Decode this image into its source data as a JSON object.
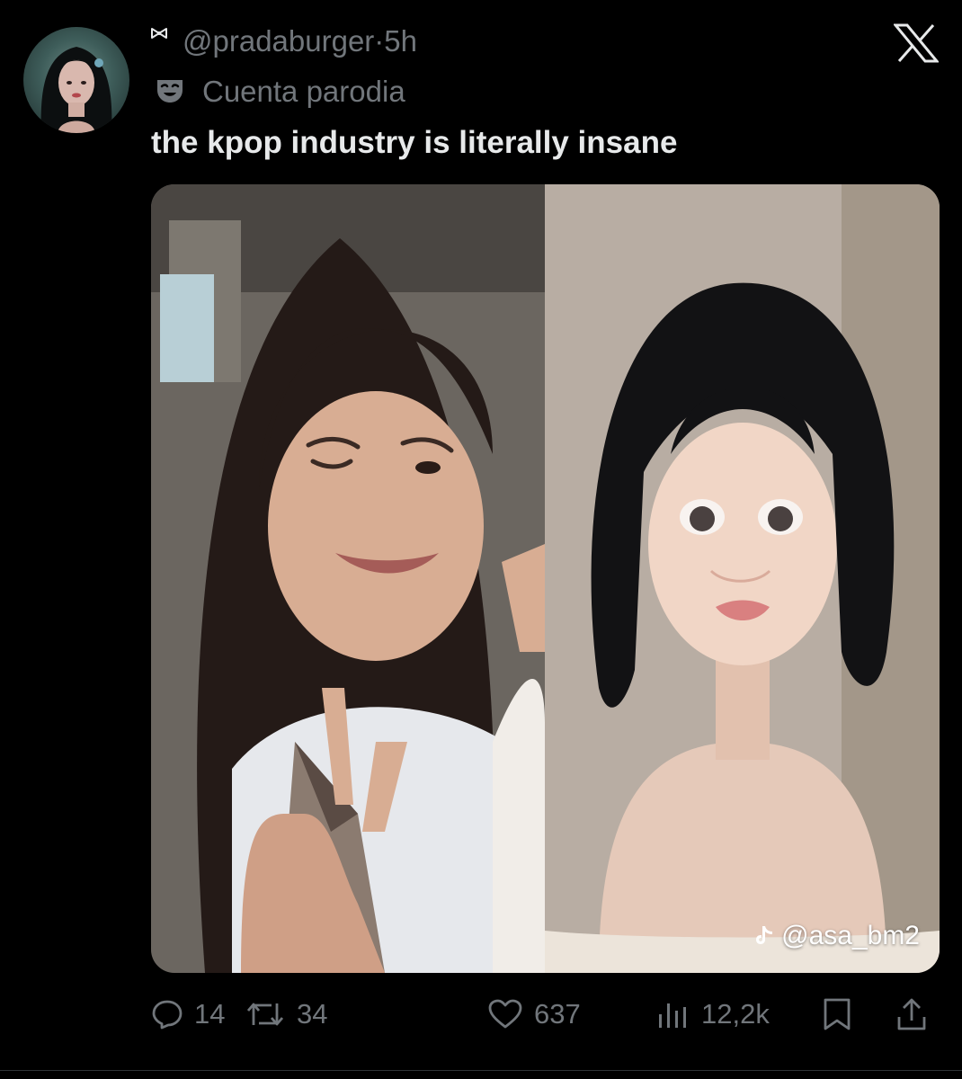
{
  "tweet": {
    "handle": "@pradaburger",
    "separator": "·",
    "time": "5h",
    "account_label": "Cuenta parodia",
    "text": "the kpop industry is literally insane",
    "avatar_icon": "user-avatar",
    "label_icon": "theater-mask-icon",
    "media": {
      "left_photo": "selfie-peace-sign-photo",
      "right_photo": "portrait-short-black-hair-photo",
      "watermark_handle": "@asa_bm2",
      "watermark_icon": "tiktok-icon"
    }
  },
  "actions": {
    "replies": "14",
    "reposts": "34",
    "likes": "637",
    "views": "12,2k"
  },
  "brand": {
    "logo": "x-logo",
    "background": "#000000",
    "text_primary": "#e7e9ea",
    "text_secondary": "#71767b"
  }
}
